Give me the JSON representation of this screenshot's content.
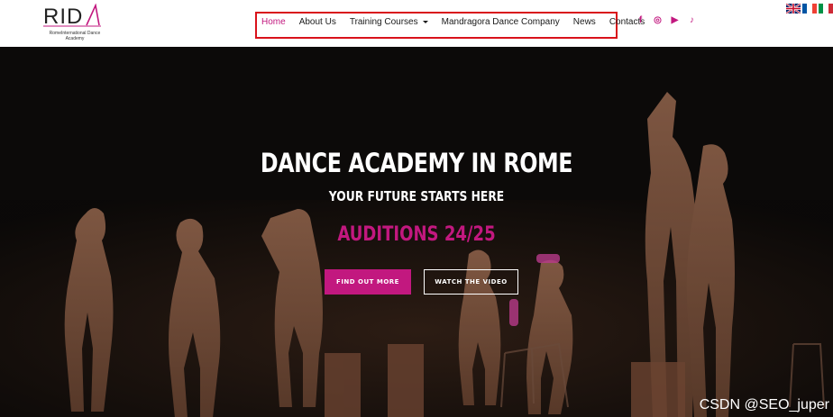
{
  "logo": {
    "mark": "RIDA",
    "subtitle": "RomeInternational Dance Academy",
    "brand_color": "#c2187f"
  },
  "nav": {
    "items": [
      {
        "label": "Home",
        "active": true
      },
      {
        "label": "About Us"
      },
      {
        "label": "Training Courses",
        "has_dropdown": true
      },
      {
        "label": "Mandragora Dance Company"
      },
      {
        "label": "News"
      },
      {
        "label": "Contacts"
      }
    ],
    "highlight_color": "#d9121b"
  },
  "social": [
    {
      "icon": "facebook-icon",
      "glyph": "f"
    },
    {
      "icon": "instagram-icon",
      "glyph": "◎"
    },
    {
      "icon": "youtube-icon",
      "glyph": "▶"
    },
    {
      "icon": "tiktok-icon",
      "glyph": "♪"
    }
  ],
  "flags": [
    "uk-flag",
    "france-flag",
    "italy-flag"
  ],
  "hero": {
    "title": "DANCE ACADEMY IN ROME",
    "subtitle": "YOUR FUTURE STARTS HERE",
    "auditions": "AUDITIONS 24/25",
    "buttons": {
      "find_out_more": "FIND OUT MORE",
      "watch_video": "WATCH THE VIDEO"
    }
  },
  "watermark": "CSDN @SEO_juper"
}
